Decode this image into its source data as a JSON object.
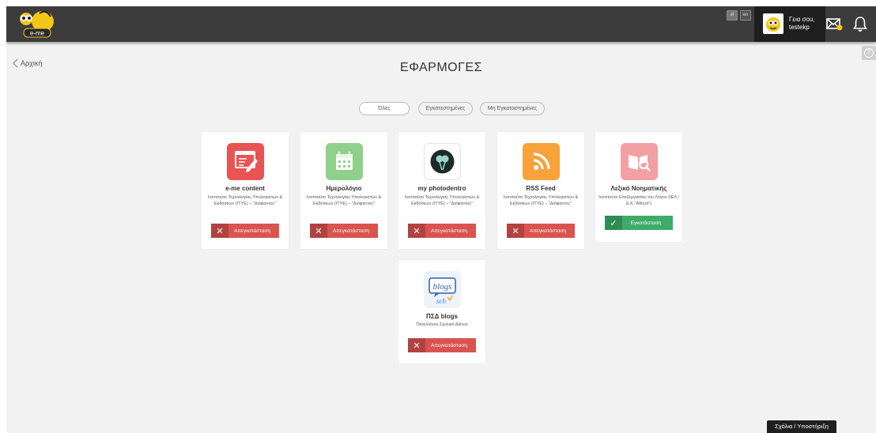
{
  "header": {
    "logo_text": "e-me",
    "languages": [
      "el",
      "en"
    ],
    "user_greeting": "Γεια σου,",
    "user_name": "testekp",
    "icons": [
      "mail-icon",
      "bell-icon",
      "help-icon"
    ]
  },
  "nav": {
    "back_label": "Αρχική"
  },
  "page": {
    "title": "ΕΦΑΡΜΟΓΕΣ"
  },
  "filters": [
    "Όλες",
    "Εγκατεστημένες",
    "Μη Εγκαταστημένες"
  ],
  "apps": [
    {
      "name": "e-me content",
      "publisher": "Ινστιτούτο Τεχνολογίας Υπολογιστών & Εκδόσεων (ΙΤΥΕ) – \"Διόφαντος\"",
      "action": "Απεγκατάσταση",
      "state": "installed",
      "icon": "content-edit-icon",
      "color": "#e95353"
    },
    {
      "name": "Ημερολόγιο",
      "publisher": "Ινστιτούτο Τεχνολογίας Υπολογιστών & Εκδόσεων (ΙΤΥΕ) – \"Διόφαντος\"",
      "action": "Απεγκατάσταση",
      "state": "installed",
      "icon": "calendar-icon",
      "color": "#8fd18a"
    },
    {
      "name": "my photodentro",
      "publisher": "Ινστιτούτο Τεχνολογίας Υπολογιστών & Εκδόσεων (ΙΤΥΕ) – \"Διόφαντος\"",
      "action": "Απεγκατάσταση",
      "state": "installed",
      "icon": "photodentro-icon",
      "color": "#ffffff"
    },
    {
      "name": "RSS Feed",
      "publisher": "Ινστιτούτο Τεχνολογίας Υπολογιστών & Εκδόσεων (ΙΤΥΕ) – \"Διόφαντος\"",
      "action": "Απεγκατάσταση",
      "state": "installed",
      "icon": "rss-icon",
      "color": "#f7a23a"
    },
    {
      "name": "Λεξικό Νοηματικής",
      "publisher": "Ινστιτούτο Επεξεργασίας του Λόγου (ΙΕΛ / Ε.Κ.\"Αθηνά\")",
      "action": "Εγκατάσταση",
      "state": "available",
      "icon": "dictionary-icon",
      "color": "#f2a0a4"
    },
    {
      "name": "ΠΣΔ blogs",
      "publisher": "Πανελλήνιο Σχολικό Δίκτυο",
      "action": "Απεγκατάσταση",
      "state": "installed",
      "icon": "blogs-icon",
      "color": "#eef3fa",
      "icon_text_top": "blogs",
      "icon_text_bottom": "sch"
    }
  ],
  "feedback_label": "Σχόλια / Υποστήριξη",
  "colors": {
    "topbar": "#3c3c3c",
    "remove": "#d9534f",
    "install": "#3fab6a",
    "background": "#f2f2f2"
  }
}
